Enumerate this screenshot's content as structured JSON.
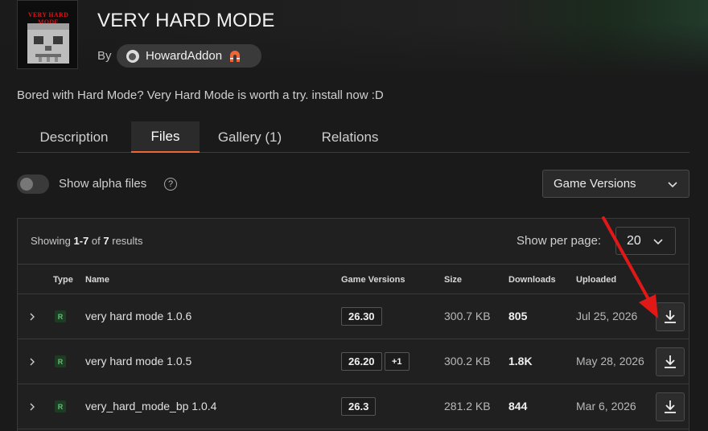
{
  "project": {
    "logo_text": "VERY HARD MODE",
    "title": "VERY HARD MODE",
    "by_label": "By",
    "author": "HowardAddon",
    "description": "Bored with Hard Mode? Very Hard Mode is worth a try. install now :D"
  },
  "tabs": [
    {
      "label": "Description",
      "active": false
    },
    {
      "label": "Files",
      "active": true
    },
    {
      "label": "Gallery (1)",
      "active": false
    },
    {
      "label": "Relations",
      "active": false
    }
  ],
  "filters": {
    "alpha_label": "Show alpha files",
    "alpha_enabled": false,
    "help_glyph": "?",
    "game_versions_label": "Game Versions"
  },
  "results": {
    "showing_prefix": "Showing",
    "range": "1-7",
    "of_label": "of",
    "total": "7",
    "suffix": "results",
    "per_page_label": "Show per page:",
    "per_page_value": "20"
  },
  "table": {
    "headers": [
      "Type",
      "Name",
      "Game Versions",
      "Size",
      "Downloads",
      "Uploaded"
    ],
    "rows": [
      {
        "type": "R",
        "name": "very hard mode 1.0.6",
        "versions": [
          "26.30"
        ],
        "size": "300.7 KB",
        "downloads": "805",
        "uploaded": "Jul 25, 2026"
      },
      {
        "type": "R",
        "name": "very hard mode 1.0.5",
        "versions": [
          "26.20",
          "+1"
        ],
        "size": "300.2 KB",
        "downloads": "1.8K",
        "uploaded": "May 28, 2026"
      },
      {
        "type": "R",
        "name": "very_hard_mode_bp 1.0.4",
        "versions": [
          "26.3"
        ],
        "size": "281.2 KB",
        "downloads": "844",
        "uploaded": "Mar 6, 2026"
      }
    ]
  },
  "colors": {
    "accent": "#f16436",
    "release_badge": "#5ec26a",
    "annotation_arrow": "#e01818"
  },
  "icons": [
    "expand-chevron-icon",
    "download-icon",
    "chevron-down-icon",
    "help-icon",
    "author-avatar-icon",
    "author-badge-icon"
  ]
}
